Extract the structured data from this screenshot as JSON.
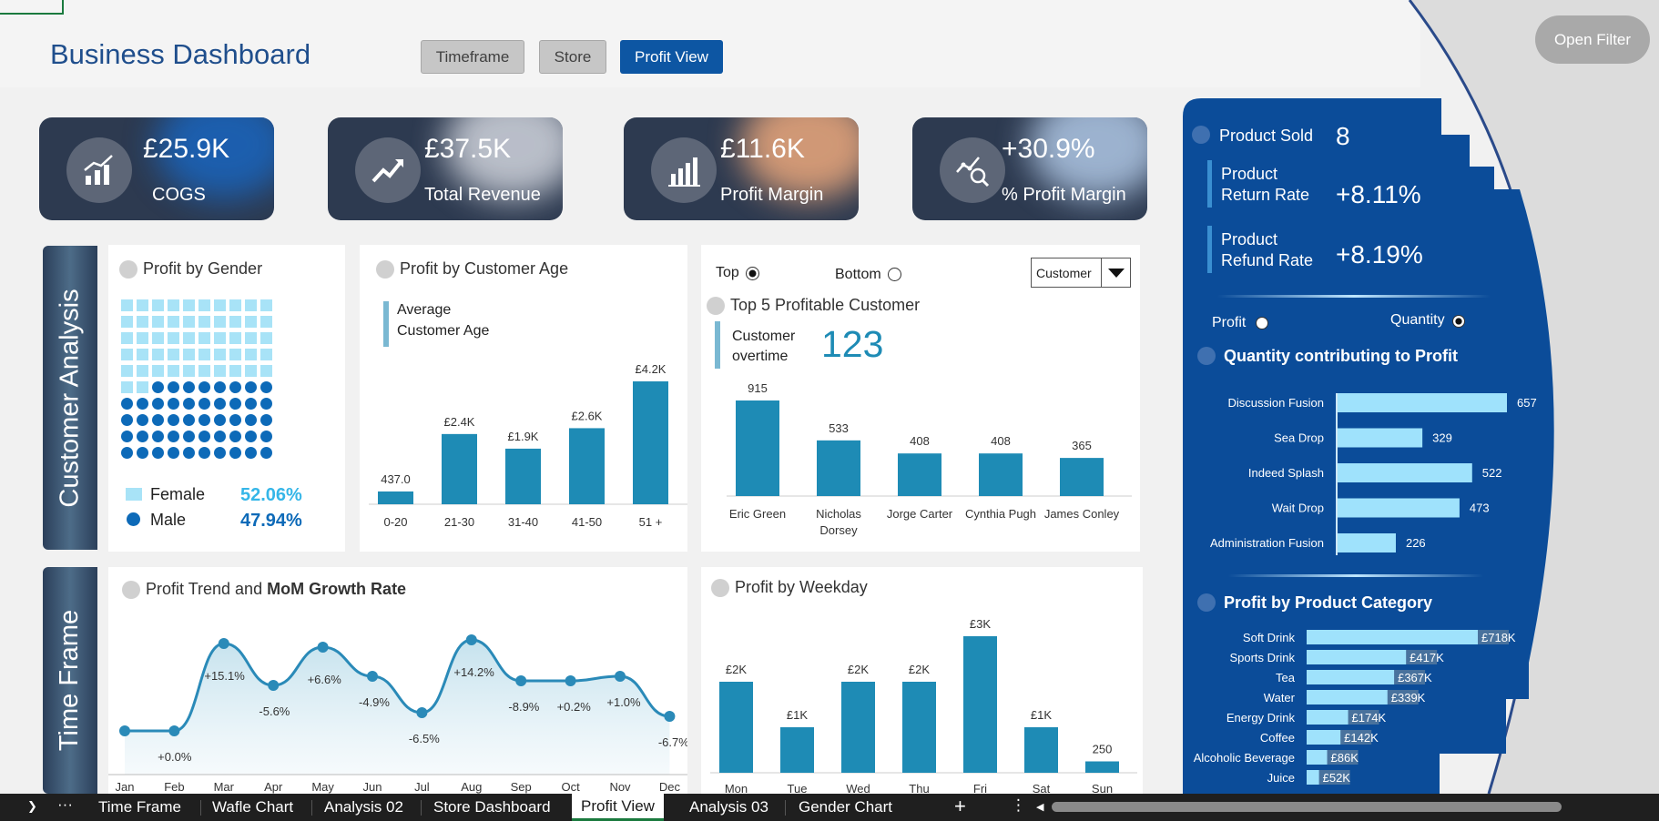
{
  "header": {
    "title": "Business Dashboard",
    "buttons": [
      "Timeframe",
      "Store",
      "Profit View"
    ],
    "open_filter": "Open Filter"
  },
  "kpis": [
    {
      "value": "£25.9K",
      "label": "COGS",
      "icon": "growth-chart-icon",
      "glow": "#1b63b8"
    },
    {
      "value": "£37.5K",
      "label": "Total Revenue",
      "icon": "trend-up-arrow-icon",
      "glow": "#c9cdd6"
    },
    {
      "value": "£11.6K",
      "label": "Profit Margin",
      "icon": "bar-chart-icon",
      "glow": "#e3a37a"
    },
    {
      "value": "+30.9%",
      "label": "% Profit Margin",
      "icon": "analytics-icon",
      "glow": "#a9c0dd"
    }
  ],
  "sections": {
    "customer": "Customer Analysis",
    "timeframe": "Time Frame"
  },
  "gender": {
    "title": "Profit by Gender",
    "female_label": "Female",
    "male_label": "Male",
    "female_pct": "52.06%",
    "male_pct": "47.94%",
    "female_share": 0.5206,
    "colors": {
      "female": "#a8e3f7",
      "male": "#0d6ab8"
    }
  },
  "age": {
    "title": "Profit by Customer Age",
    "note_line1": "Average",
    "note_line2": "Customer Age"
  },
  "customers": {
    "top_label": "Top",
    "bottom_label": "Bottom",
    "dropdown": "Customer",
    "title": "Top 5 Profitable Customer",
    "note_line1": "Customer",
    "note_line2": "overtime",
    "count": "123"
  },
  "trend": {
    "title_prefix": "Profit Trend and ",
    "title_bold": "MoM Growth Rate"
  },
  "weekday": {
    "title": "Profit by Weekday"
  },
  "right": {
    "product_sold_label": "Product Sold",
    "product_sold": "8",
    "return_line1": "Product",
    "return_line2": "Return Rate",
    "return_rate": "+8.11%",
    "refund_line1": "Product",
    "refund_line2": "Refund Rate",
    "refund_rate": "+8.19%",
    "toggle_profit": "Profit",
    "toggle_quantity": "Quantity",
    "qty_title": "Quantity contributing to Profit",
    "cat_title": "Profit by Product Category"
  },
  "tabs": [
    "Time Frame",
    "Wafle Chart",
    "Analysis 02",
    "Store Dashboard",
    "Profit View",
    "Analysis 03",
    "Gender Chart"
  ],
  "chart_data": [
    {
      "type": "bar",
      "title": "Profit by Customer Age",
      "categories": [
        "0-20",
        "21-30",
        "31-40",
        "41-50",
        "51 +"
      ],
      "values": [
        437,
        2400,
        1900,
        2600,
        4200
      ],
      "labels": [
        "437.0",
        "£2.4K",
        "£1.9K",
        "£2.6K",
        "£4.2K"
      ]
    },
    {
      "type": "bar",
      "title": "Top 5 Profitable Customer",
      "categories": [
        "Eric Green",
        "Nicholas Dorsey",
        "Jorge Carter",
        "Cynthia Pugh",
        "James Conley"
      ],
      "values": [
        915,
        533,
        408,
        408,
        365
      ]
    },
    {
      "type": "area",
      "title": "Profit Trend and MoM Growth Rate",
      "categories": [
        "Jan",
        "Feb",
        "Mar",
        "Apr",
        "May",
        "Jun",
        "Jul",
        "Aug",
        "Sep",
        "Oct",
        "Nov",
        "Dec"
      ],
      "values": [
        1.0,
        1.0,
        1.96,
        1.5,
        1.92,
        1.6,
        1.2,
        2.0,
        1.55,
        1.55,
        1.6,
        1.16
      ],
      "growth_labels": [
        "",
        "+0.0%",
        "+15.1%",
        "-5.6%",
        "+6.6%",
        "-4.9%",
        "-6.5%",
        "+14.2%",
        "-8.9%",
        "+0.2%",
        "+1.0%",
        "-6.7%"
      ]
    },
    {
      "type": "bar",
      "title": "Profit by Weekday",
      "categories": [
        "Mon",
        "Tue",
        "Wed",
        "Thu",
        "Fri",
        "Sat",
        "Sun"
      ],
      "values": [
        2000,
        1000,
        2000,
        2000,
        3000,
        1000,
        250
      ],
      "labels": [
        "£2K",
        "£1K",
        "£2K",
        "£2K",
        "£3K",
        "£1K",
        "250"
      ]
    },
    {
      "type": "bar",
      "orientation": "horizontal",
      "title": "Quantity contributing to Profit",
      "categories": [
        "Discussion Fusion",
        "Sea Drop",
        "Indeed Splash",
        "Wait Drop",
        "Administration Fusion"
      ],
      "values": [
        657,
        329,
        522,
        473,
        226
      ]
    },
    {
      "type": "bar",
      "orientation": "horizontal",
      "title": "Profit by Product Category",
      "categories": [
        "Soft Drink",
        "Sports Drink",
        "Tea",
        "Water",
        "Energy Drink",
        "Coffee",
        "Alcoholic Beverage",
        "Juice"
      ],
      "values": [
        718,
        417,
        367,
        339,
        174,
        142,
        86,
        52
      ],
      "labels": [
        "£718K",
        "£417K",
        "£367K",
        "£339K",
        "£174K",
        "£142K",
        "£86K",
        "£52K"
      ]
    }
  ]
}
